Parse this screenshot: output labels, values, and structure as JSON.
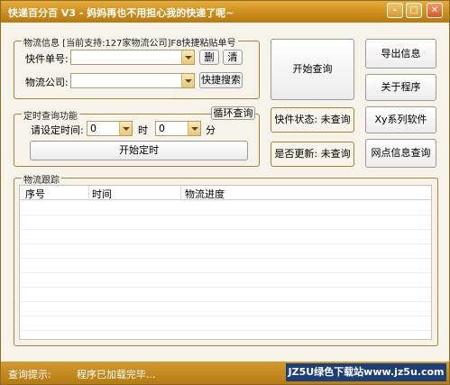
{
  "window": {
    "title": "快递百分百 V3 - 妈妈再也不用担心我的快递了呢~",
    "min_glyph": "–",
    "max_glyph": "□",
    "close_glyph": "✕"
  },
  "info_group": {
    "legend": "物流信息 [当前支持:127家物流公司]F8快捷粘贴单号",
    "tracking_label": "快件单号:",
    "tracking_value": "",
    "delete_label": "删",
    "clear_label": "清",
    "company_label": "物流公司:",
    "company_value": "",
    "quick_search_label": "快捷搜索"
  },
  "timer_group": {
    "legend": "定时查询功能",
    "loop_label": "循环查询",
    "set_time_label": "请设定时间:",
    "hour_value": "0",
    "hour_unit": "时",
    "minute_value": "0",
    "minute_unit": "分",
    "start_timer_label": "开始定时"
  },
  "actions": {
    "start_query": "开始查询",
    "export_info": "导出信息",
    "about": "关于程序",
    "xy_series": "Xy系列软件",
    "outlet_query": "网点信息查询"
  },
  "status": {
    "express_status": "快件状态: 未查询",
    "updated_status": "是否更新: 未查询"
  },
  "tracking": {
    "legend": "物流跟踪",
    "columns": [
      "序号",
      "时间",
      "物流进度"
    ]
  },
  "statusbar": {
    "label": "查询提示:",
    "message": "程序已加载完毕...",
    "brand": "JZ5U绿色下载站www.jz5u.com"
  },
  "colors": {
    "titlebar": "#c98b1a",
    "group_border": "#a9823e",
    "brand_bg": "#1c3f7a"
  }
}
